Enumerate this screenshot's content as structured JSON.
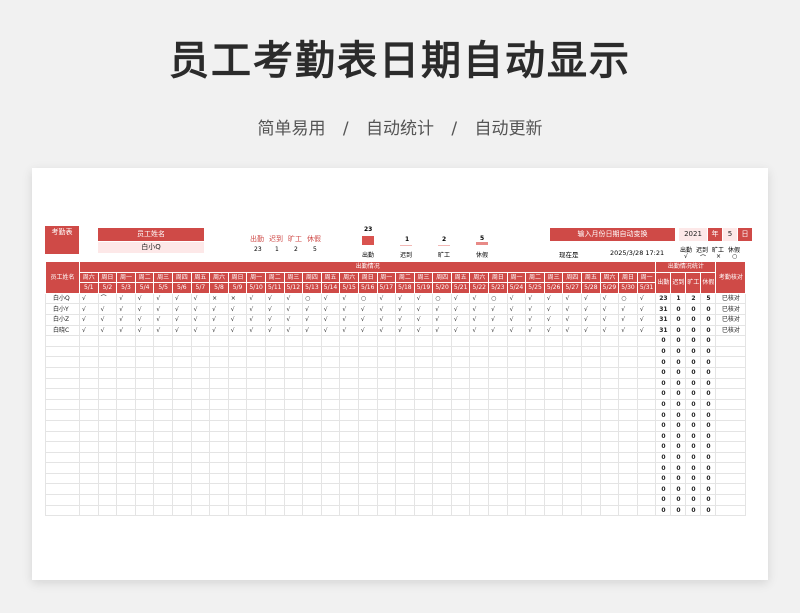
{
  "title": "员工考勤表日期自动显示",
  "subtitle": [
    "简单易用",
    "/",
    "自动统计",
    "/",
    "自动更新"
  ],
  "colors": {
    "accent": "#cf4a47"
  },
  "sheet": {
    "corner_label": "考勤表",
    "name_label": "员工姓名",
    "name_value": "白小Q",
    "stat_labels": [
      "出勤",
      "迟到",
      "旷工",
      "休假"
    ],
    "stat_values": [
      "23",
      "1",
      "2",
      "5"
    ],
    "chart_items": [
      {
        "label": "出勤",
        "value": "23"
      },
      {
        "label": "迟到",
        "value": "1"
      },
      {
        "label": "旷工",
        "value": "2"
      },
      {
        "label": "休假",
        "value": "5"
      }
    ],
    "month_prompt": "输入月份日期自动变换",
    "year": "2021",
    "year_unit": "年",
    "month": "5",
    "month_unit": "日",
    "now_label": "现在是",
    "now_value": "2025/3/28 17:21",
    "legend_labels": [
      "出勤",
      "迟到",
      "旷工",
      "休假"
    ],
    "legend_symbols": [
      "√",
      "⌒",
      "×",
      "○"
    ],
    "name_col_header": "员工姓名",
    "attendance_header": "出勤情况",
    "stats_header": "出勤情况统计",
    "stats_cols": [
      "出勤",
      "迟到",
      "旷工",
      "休假"
    ],
    "check_header": "考勤核对",
    "weekdays": [
      "周六",
      "周日",
      "周一",
      "周二",
      "周三",
      "周四",
      "周五",
      "周六",
      "周日",
      "周一",
      "周二",
      "周三",
      "周四",
      "周五",
      "周六",
      "周日",
      "周一",
      "周二",
      "周三",
      "周四",
      "周五",
      "周六",
      "周日",
      "周一",
      "周二",
      "周三",
      "周四",
      "周五",
      "周六",
      "周日",
      "周一"
    ],
    "dates": [
      "5/1",
      "5/2",
      "5/3",
      "5/4",
      "5/5",
      "5/6",
      "5/7",
      "5/8",
      "5/9",
      "5/10",
      "5/11",
      "5/12",
      "5/13",
      "5/14",
      "5/15",
      "5/16",
      "5/17",
      "5/18",
      "5/19",
      "5/20",
      "5/21",
      "5/22",
      "5/23",
      "5/24",
      "5/25",
      "5/26",
      "5/27",
      "5/28",
      "5/29",
      "5/30",
      "5/31"
    ],
    "rows": [
      {
        "name": "白小Q",
        "marks": [
          "√",
          "⌒",
          "√",
          "√",
          "√",
          "√",
          "√",
          "×",
          "×",
          "√",
          "√",
          "√",
          "○",
          "√",
          "√",
          "○",
          "√",
          "√",
          "√",
          "○",
          "√",
          "√",
          "○",
          "√",
          "√",
          "√",
          "√",
          "√",
          "√",
          "○",
          "√"
        ],
        "counts": [
          "23",
          "1",
          "2",
          "5"
        ],
        "check": "已核对"
      },
      {
        "name": "白小Y",
        "marks": [
          "√",
          "√",
          "√",
          "√",
          "√",
          "√",
          "√",
          "√",
          "√",
          "√",
          "√",
          "√",
          "√",
          "√",
          "√",
          "√",
          "√",
          "√",
          "√",
          "√",
          "√",
          "√",
          "√",
          "√",
          "√",
          "√",
          "√",
          "√",
          "√",
          "√",
          "√"
        ],
        "counts": [
          "31",
          "0",
          "0",
          "0"
        ],
        "check": "已核对"
      },
      {
        "name": "白小Z",
        "marks": [
          "√",
          "√",
          "√",
          "√",
          "√",
          "√",
          "√",
          "√",
          "√",
          "√",
          "√",
          "√",
          "√",
          "√",
          "√",
          "√",
          "√",
          "√",
          "√",
          "√",
          "√",
          "√",
          "√",
          "√",
          "√",
          "√",
          "√",
          "√",
          "√",
          "√",
          "√"
        ],
        "counts": [
          "31",
          "0",
          "0",
          "0"
        ],
        "check": "已核对"
      },
      {
        "name": "白晓C",
        "marks": [
          "√",
          "√",
          "√",
          "√",
          "√",
          "√",
          "√",
          "√",
          "√",
          "√",
          "√",
          "√",
          "√",
          "√",
          "√",
          "√",
          "√",
          "√",
          "√",
          "√",
          "√",
          "√",
          "√",
          "√",
          "√",
          "√",
          "√",
          "√",
          "√",
          "√",
          "√"
        ],
        "counts": [
          "31",
          "0",
          "0",
          "0"
        ],
        "check": "已核对"
      }
    ],
    "empty_counts": [
      "0",
      "0",
      "0",
      "0"
    ],
    "empty_row_count": 17
  }
}
